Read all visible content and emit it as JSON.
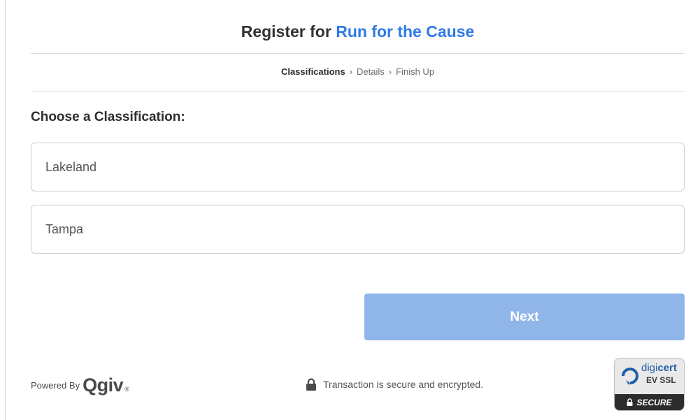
{
  "header": {
    "prefix": "Register for",
    "event_name": "Run for the Cause"
  },
  "steps": [
    {
      "label": "Classifications",
      "current": true
    },
    {
      "label": "Details",
      "current": false
    },
    {
      "label": "Finish Up",
      "current": false
    }
  ],
  "step_separator": "›",
  "section_title": "Choose a Classification:",
  "options": [
    {
      "label": "Lakeland"
    },
    {
      "label": "Tampa"
    }
  ],
  "next_button": {
    "label": "Next"
  },
  "footer": {
    "powered_by": "Powered By",
    "brand": "Qgiv",
    "brand_mark": "®",
    "secure_text": "Transaction is secure and encrypted."
  },
  "ssl_badge": {
    "brand_prefix": "digi",
    "brand_suffix": "cert",
    "type": "EV SSL",
    "status": "SECURE"
  },
  "colors": {
    "accent": "#2f7ae5",
    "button_disabled": "#90b6e9",
    "border": "#c9cdd1"
  }
}
